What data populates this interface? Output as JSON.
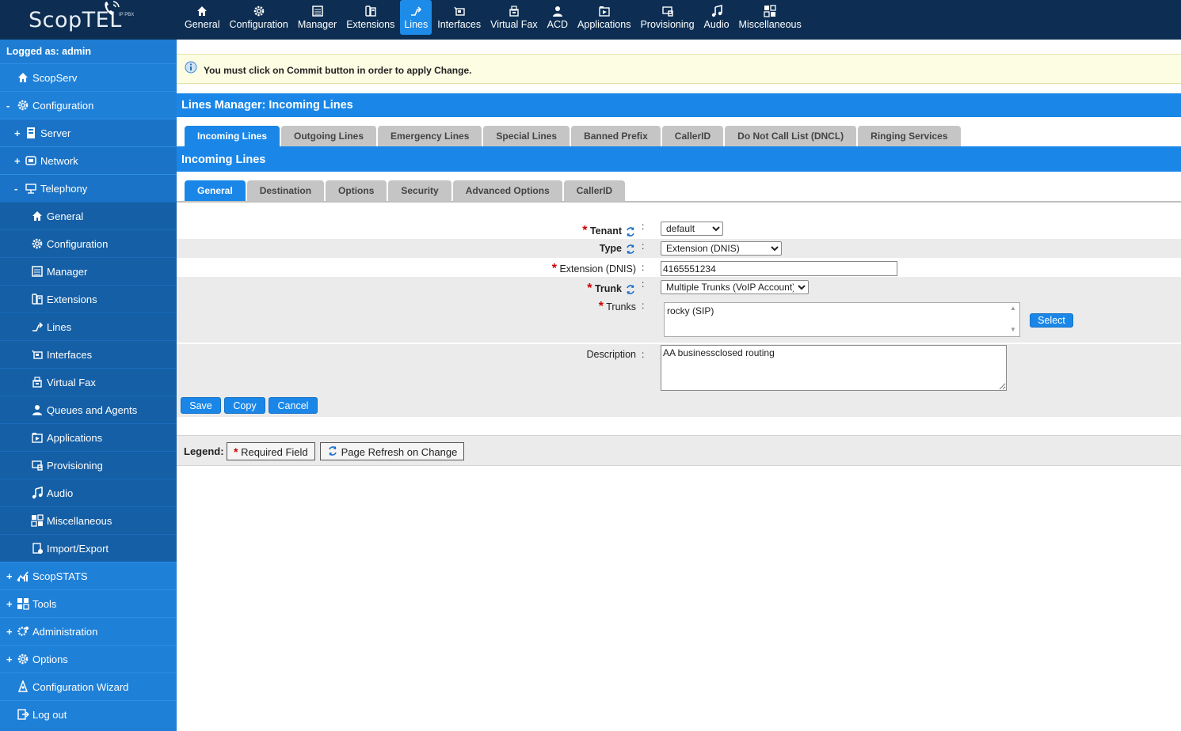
{
  "logo": {
    "text": "ScopTEL",
    "sub": "IP PBX"
  },
  "topnav": [
    {
      "label": "General",
      "icon": "home-icon"
    },
    {
      "label": "Configuration",
      "icon": "gear-icon"
    },
    {
      "label": "Manager",
      "icon": "manager-icon"
    },
    {
      "label": "Extensions",
      "icon": "phone-icon"
    },
    {
      "label": "Lines",
      "icon": "lines-icon",
      "active": true
    },
    {
      "label": "Interfaces",
      "icon": "interfaces-icon"
    },
    {
      "label": "Virtual Fax",
      "icon": "fax-icon"
    },
    {
      "label": "ACD",
      "icon": "agent-icon"
    },
    {
      "label": "Applications",
      "icon": "applications-icon"
    },
    {
      "label": "Provisioning",
      "icon": "provisioning-icon"
    },
    {
      "label": "Audio",
      "icon": "music-icon"
    },
    {
      "label": "Miscellaneous",
      "icon": "misc-icon"
    }
  ],
  "sidebar": {
    "logged_as": "Logged as: admin",
    "items": [
      {
        "label": "ScopServ",
        "toggle": "",
        "level": 0,
        "icon": "home-icon"
      },
      {
        "label": "Configuration",
        "toggle": "-",
        "level": 0,
        "icon": "gear-icon"
      },
      {
        "label": "Server",
        "toggle": "+",
        "level": 1,
        "icon": "server-icon"
      },
      {
        "label": "Network",
        "toggle": "+",
        "level": 1,
        "icon": "network-icon"
      },
      {
        "label": "Telephony",
        "toggle": "-",
        "level": 1,
        "icon": "telephony-icon"
      },
      {
        "label": "General",
        "toggle": "",
        "level": 2,
        "icon": "home-icon"
      },
      {
        "label": "Configuration",
        "toggle": "",
        "level": 2,
        "icon": "gear-icon"
      },
      {
        "label": "Manager",
        "toggle": "",
        "level": 2,
        "icon": "manager-icon"
      },
      {
        "label": "Extensions",
        "toggle": "",
        "level": 2,
        "icon": "phone-icon"
      },
      {
        "label": "Lines",
        "toggle": "",
        "level": 2,
        "icon": "lines-icon"
      },
      {
        "label": "Interfaces",
        "toggle": "",
        "level": 2,
        "icon": "interfaces-icon"
      },
      {
        "label": "Virtual Fax",
        "toggle": "",
        "level": 2,
        "icon": "fax-icon"
      },
      {
        "label": "Queues and Agents",
        "toggle": "",
        "level": 2,
        "icon": "agent-icon"
      },
      {
        "label": "Applications",
        "toggle": "",
        "level": 2,
        "icon": "applications-icon"
      },
      {
        "label": "Provisioning",
        "toggle": "",
        "level": 2,
        "icon": "provisioning-icon"
      },
      {
        "label": "Audio",
        "toggle": "",
        "level": 2,
        "icon": "music-icon"
      },
      {
        "label": "Miscellaneous",
        "toggle": "",
        "level": 2,
        "icon": "misc-icon"
      },
      {
        "label": "Import/Export",
        "toggle": "",
        "level": 2,
        "icon": "import-export-icon"
      },
      {
        "label": "ScopSTATS",
        "toggle": "+",
        "level": 0,
        "icon": "stats-icon"
      },
      {
        "label": "Tools",
        "toggle": "+",
        "level": 0,
        "icon": "tools-icon"
      },
      {
        "label": "Administration",
        "toggle": "+",
        "level": 0,
        "icon": "admin-gear-icon"
      },
      {
        "label": "Options",
        "toggle": "+",
        "level": 0,
        "icon": "gear-icon"
      },
      {
        "label": "Configuration Wizard",
        "toggle": "",
        "level": 0,
        "icon": "wizard-icon"
      },
      {
        "label": "Log out",
        "toggle": "",
        "level": 0,
        "icon": "logout-icon"
      }
    ]
  },
  "notice": "You must click on Commit button in order to apply Change.",
  "title": "Lines Manager:  Incoming Lines",
  "tabs_main": [
    "Incoming Lines",
    "Outgoing Lines",
    "Emergency Lines",
    "Special Lines",
    "Banned Prefix",
    "CallerID",
    "Do Not Call List (DNCL)",
    "Ringing Services"
  ],
  "section_title": "Incoming Lines",
  "tabs_sub": [
    "General",
    "Destination",
    "Options",
    "Security",
    "Advanced Options",
    "CallerID"
  ],
  "form": {
    "tenant": {
      "label": "Tenant",
      "value": "default"
    },
    "type": {
      "label": "Type",
      "value": "Extension (DNIS)"
    },
    "extension": {
      "label": "Extension (DNIS)",
      "value": "4165551234"
    },
    "trunk": {
      "label": "Trunk",
      "value": "Multiple Trunks (VoIP Account)"
    },
    "trunks": {
      "label": "Trunks",
      "value": "rocky (SIP)",
      "select_label": "Select"
    },
    "description": {
      "label": "Description",
      "value": "AA businessclosed routing"
    },
    "colon": ":",
    "req_mark": "*"
  },
  "buttons": {
    "save": "Save",
    "copy": "Copy",
    "cancel": "Cancel"
  },
  "legend": {
    "title": "Legend:",
    "required": "Required Field",
    "refresh": "Page Refresh on Change"
  },
  "colors": {
    "topbar": "#0d2e52",
    "accent": "#1a87e8",
    "sidebar": "#1f7fd6",
    "notice_bg": "#fdfde4",
    "required": "#cc0000"
  }
}
